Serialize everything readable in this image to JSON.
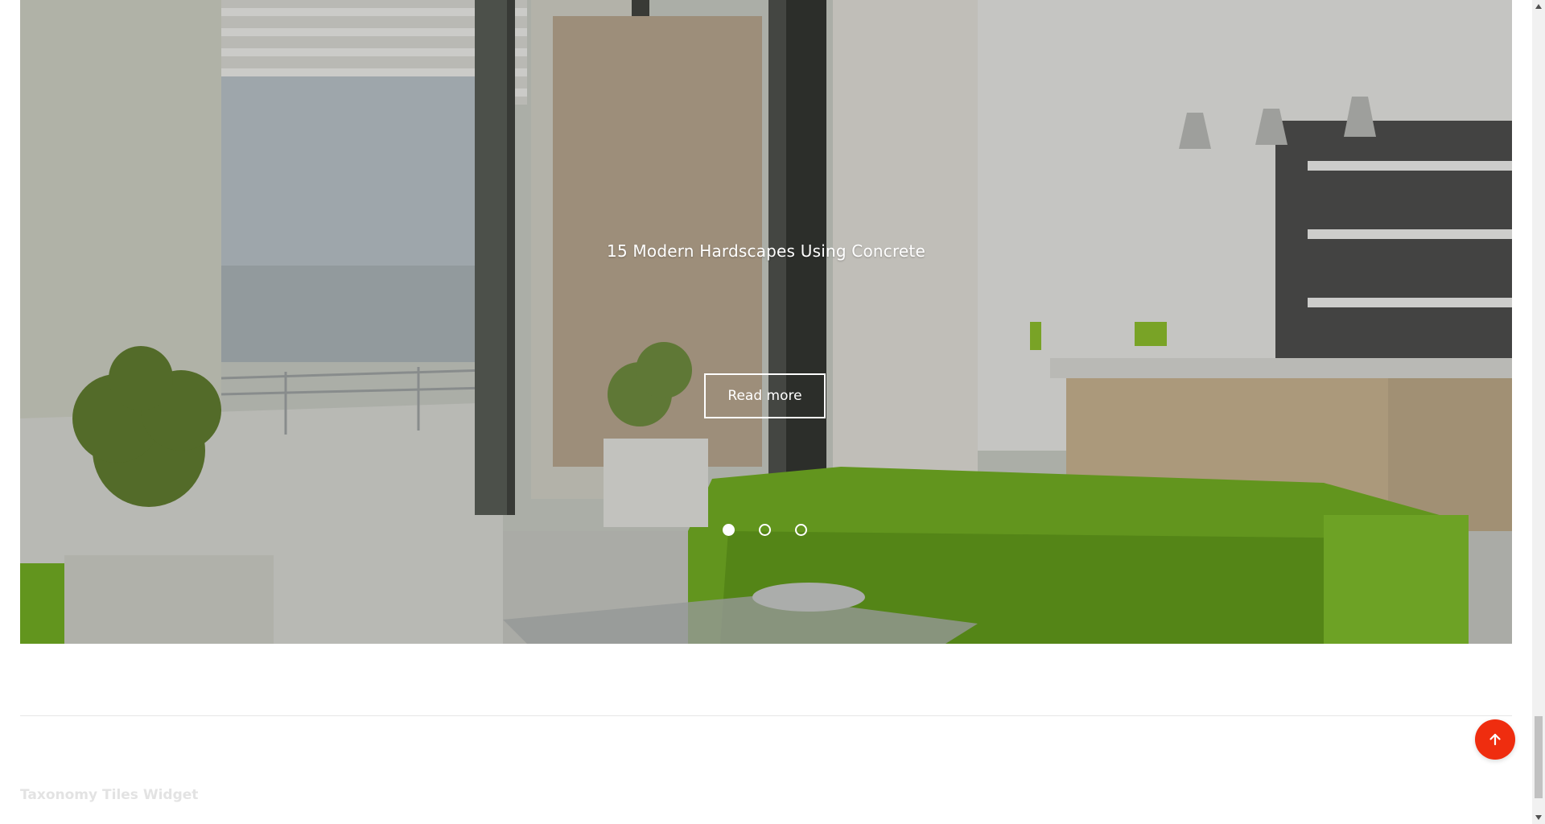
{
  "hero": {
    "slide_title": "15 Modern Hardscapes Using Concrete",
    "read_more_label": "Read more",
    "dots": [
      {
        "state": "active"
      },
      {
        "state": "inactive"
      },
      {
        "state": "inactive"
      }
    ]
  },
  "footer": {
    "widget_title": "Taxonomy Tiles Widget"
  },
  "back_to_top": {
    "icon": "arrow-up-icon",
    "color": "#ef2d0f"
  },
  "colors": {
    "sofa_green": "#6fae1d",
    "accent_red": "#ef2d0f"
  }
}
